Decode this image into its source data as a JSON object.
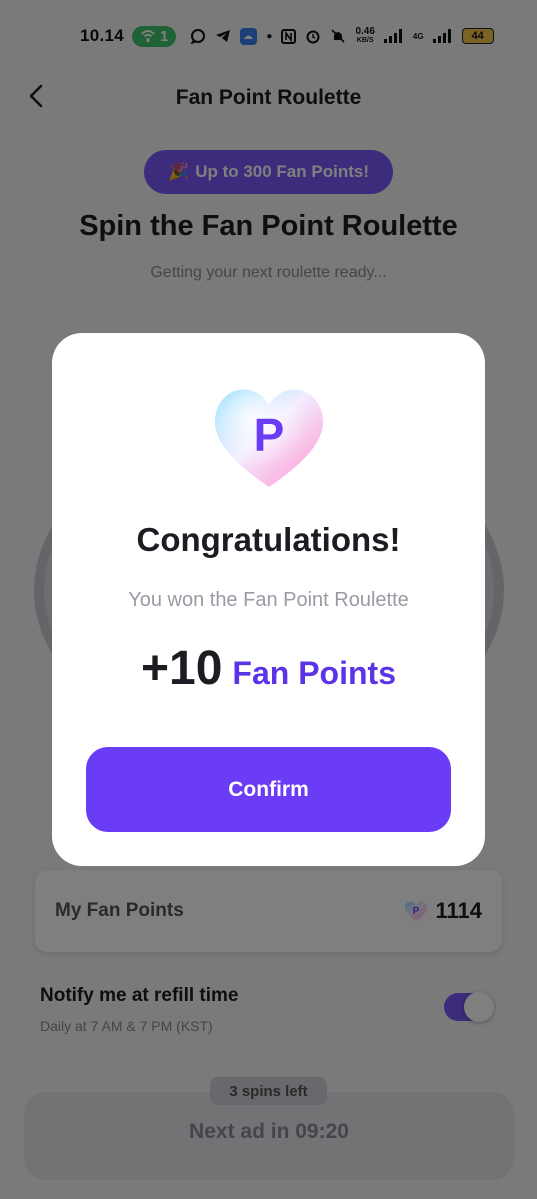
{
  "status_bar": {
    "time": "10.14",
    "hotspot_count": "1",
    "net_speed_value": "0.46",
    "net_speed_unit": "KB/S",
    "network_type": "4G",
    "battery": "44"
  },
  "header": {
    "title": "Fan Point Roulette",
    "back_icon": "chevron-left-icon"
  },
  "promo": {
    "emoji": "🎉",
    "label": "Up to 300 Fan Points!"
  },
  "hero": {
    "title": "Spin the Fan Point Roulette",
    "subtitle": "Getting your next roulette ready..."
  },
  "my_points": {
    "label": "My Fan Points",
    "value": "1114",
    "icon": "fan-point-heart-icon"
  },
  "notify": {
    "title": "Notify me at refill time",
    "subtitle": "Daily at 7 AM & 7 PM (KST)",
    "enabled": true
  },
  "spins": {
    "left_label": "3 spins left",
    "next_ad": "Next ad in 09:20"
  },
  "modal": {
    "icon": "fan-point-heart-icon",
    "icon_letter": "P",
    "title": "Congratulations!",
    "subtitle": "You won the Fan Point Roulette",
    "amount": "+10",
    "unit": "Fan Points",
    "confirm_label": "Confirm"
  },
  "colors": {
    "accent": "#6a3cf5",
    "accent_text": "#5b34e8",
    "promo_pill": "#7b58f7"
  }
}
